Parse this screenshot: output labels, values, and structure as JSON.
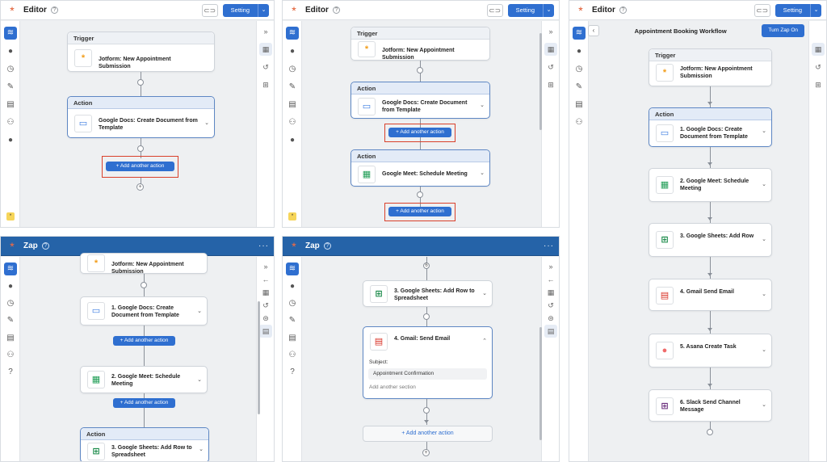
{
  "editor": {
    "title": "Editor",
    "setting": "Setting"
  },
  "zap": {
    "title": "Zap",
    "menu": "···"
  },
  "workflow": {
    "title": "Appointment Booking Workflow",
    "turn_on": "Turn Zap On"
  },
  "labels": {
    "trigger": "Trigger",
    "action": "Action"
  },
  "add_action": "+ Add another action",
  "steps": {
    "jotform": "Jotform: New Appointment Submission",
    "docs": "Google Docs: Create Document from Template",
    "meet": "Google Meet: Schedule Meeting",
    "docs_n": "1. Google Docs: Create Document from Template",
    "meet_n": "2. Google Meet: Schedule Meeting",
    "sheets_n": "3. Google Sheets: Add Row",
    "gmail_n": "4. Gmail Send Email",
    "asana_n": "5. Asana Create Task",
    "slack_n": "6. Slack Send Channel Message",
    "sheets_full": "3. Google Sheets: Add Row to Spreadsheet",
    "gmail_colon": "4. Gmail: Send Email"
  },
  "gmail_detail": {
    "subject_label": "Subject:",
    "subject_value": "Appointment Confirmation",
    "add_section": "Add another section"
  },
  "step_number": "6",
  "icons": {
    "logo": "*",
    "help": "?",
    "link": "⊂⊃",
    "dropdown": "⌄",
    "layers": "≋",
    "info": "●",
    "clock": "◷",
    "pen": "✎",
    "doc": "▤",
    "tree": "⚇",
    "expand": "»",
    "collapse": "«",
    "calendar": "▦",
    "history": "↺",
    "grid": "⊞",
    "chevron": "⌄",
    "chevron_up": "⌃",
    "back": "‹",
    "plus": "+",
    "arrow_left": "←",
    "stack": "⊜",
    "file": "▭"
  }
}
